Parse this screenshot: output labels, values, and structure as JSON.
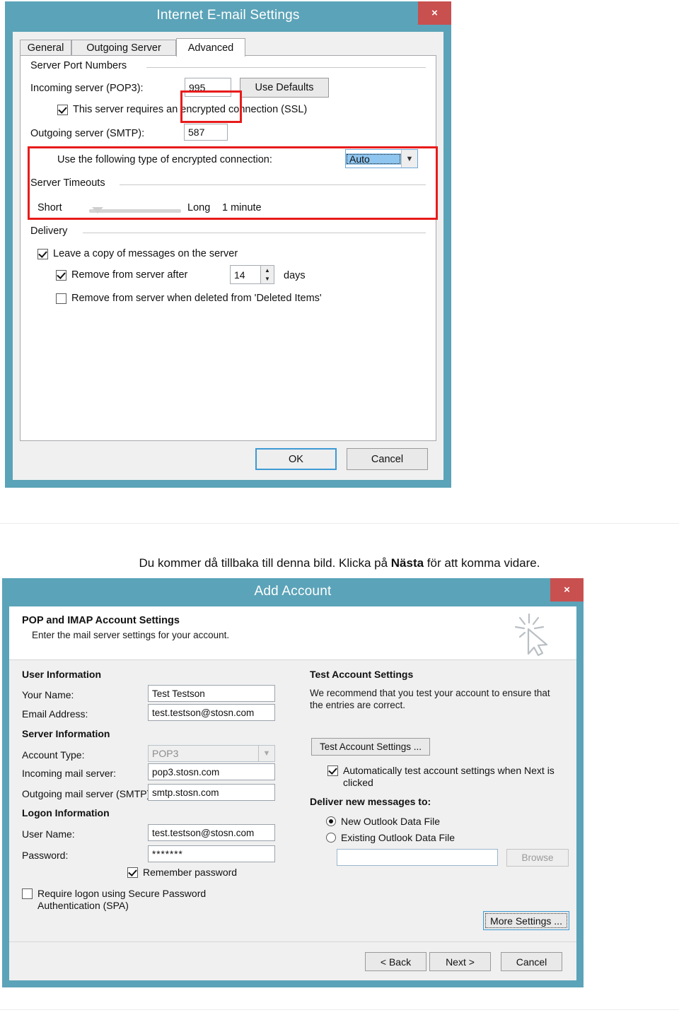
{
  "colors": {
    "frame_teal": "#5ba3b8",
    "close_red": "#c8504f",
    "annotation_red": "#e81b1b",
    "select_blue": "#8ec6f0"
  },
  "dialog1": {
    "title": "Internet E-mail Settings",
    "close_label": "×",
    "close_icon": "close-icon",
    "tabs": [
      {
        "label": "General",
        "active": false
      },
      {
        "label": "Outgoing Server",
        "active": false
      },
      {
        "label": "Advanced",
        "active": true
      }
    ],
    "groups": {
      "server_port_numbers": "Server Port Numbers",
      "server_timeouts": "Server Timeouts",
      "delivery": "Delivery"
    },
    "incoming_label": "Incoming server (POP3):",
    "incoming_value": "995",
    "use_defaults_label": "Use Defaults",
    "ssl_checkbox": {
      "label": "This server requires an encrypted connection (SSL)",
      "checked": true
    },
    "outgoing_label": "Outgoing server (SMTP):",
    "outgoing_value": "587",
    "encrypt_type_label": "Use the following type of encrypted connection:",
    "encrypt_type_value": "Auto",
    "timeout_short": "Short",
    "timeout_long": "Long",
    "timeout_value": "1 minute",
    "delivery": {
      "leave_copy": {
        "label": "Leave a copy of messages on the server",
        "checked": true
      },
      "remove_after": {
        "label": "Remove from server after",
        "checked": true
      },
      "remove_after_value": "14",
      "days_label": "days",
      "remove_deleted": {
        "label": "Remove from server when deleted from 'Deleted Items'",
        "checked": false
      }
    },
    "ok_label": "OK",
    "cancel_label": "Cancel"
  },
  "caption": {
    "part1": "Du kommer då tillbaka till denna bild. Klicka på ",
    "bold": "Nästa",
    "part2": " för att komma vidare."
  },
  "dialog2": {
    "title": "Add Account",
    "close_label": "×",
    "close_icon": "close-icon",
    "header_title": "POP and IMAP Account Settings",
    "header_subtitle": "Enter the mail server settings for your account.",
    "cursor_icon": "click-cursor-icon",
    "user_information": {
      "section": "User Information",
      "your_name_label": "Your Name:",
      "your_name_value": "Test Testson",
      "email_label": "Email Address:",
      "email_value": "test.testson@stosn.com"
    },
    "server_information": {
      "section": "Server Information",
      "account_type_label": "Account Type:",
      "account_type_value": "POP3",
      "incoming_label": "Incoming mail server:",
      "incoming_value": "pop3.stosn.com",
      "outgoing_label": "Outgoing mail server (SMTP):",
      "outgoing_value": "smtp.stosn.com"
    },
    "logon_information": {
      "section": "Logon Information",
      "username_label": "User Name:",
      "username_value": "test.testson@stosn.com",
      "password_label": "Password:",
      "password_value": "*******",
      "remember_password": {
        "label": "Remember password",
        "checked": true
      },
      "spa": {
        "label": "Require logon using Secure Password Authentication (SPA)",
        "checked": false
      }
    },
    "test_account": {
      "section": "Test Account Settings",
      "help_text": "We recommend that you test your account to ensure that the entries are correct.",
      "button_label": "Test Account Settings ...",
      "auto_test": {
        "label": "Automatically test account settings when Next is clicked",
        "checked": true
      },
      "deliver_label": "Deliver new messages to:",
      "radio_new": {
        "label": "New Outlook Data File",
        "selected": true
      },
      "radio_existing": {
        "label": "Existing Outlook Data File",
        "selected": false
      },
      "existing_path_value": "",
      "browse_label": "Browse",
      "more_settings_label": "More Settings ..."
    },
    "footer": {
      "back_label": "< Back",
      "next_label": "Next >",
      "cancel_label": "Cancel"
    }
  }
}
